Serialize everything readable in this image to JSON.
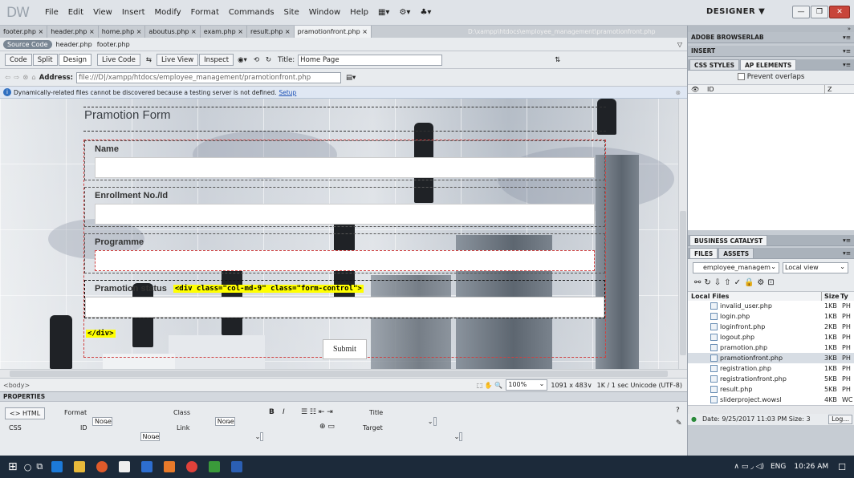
{
  "app": {
    "logo": "DW",
    "menu": [
      "File",
      "Edit",
      "View",
      "Insert",
      "Modify",
      "Format",
      "Commands",
      "Site",
      "Window",
      "Help"
    ],
    "workspace": "DESIGNER ▼",
    "window_controls": [
      "—",
      "❐",
      "✕"
    ]
  },
  "doc_tabs": [
    "footer.php ×",
    "header.php ×",
    "home.php ×",
    "aboutus.php ×",
    "exam.php ×",
    "result.php ×",
    "pramotionfront.php ×"
  ],
  "doc_path": "D:\\xampp\\htdocs\\employee_management\\pramotionfront.php",
  "related": {
    "source": "Source Code",
    "files": [
      "header.php",
      "footer.php"
    ]
  },
  "viewbar": {
    "buttons": [
      "Code",
      "Split",
      "Design",
      "Live Code",
      "Live View",
      "Inspect"
    ],
    "title_label": "Title:",
    "title_value": "Home Page"
  },
  "address": {
    "label": "Address:",
    "value": "file:///D|/xampp/htdocs/employee_management/pramotionfront.php"
  },
  "info": {
    "text": "Dynamically-related files cannot be discovered because a testing server is not defined.",
    "link": "Setup"
  },
  "form": {
    "heading": "Pramotion Form",
    "fields": [
      {
        "label": "Name"
      },
      {
        "label": "Enrollment No./Id"
      },
      {
        "label": "Programme"
      },
      {
        "label": "Pramotion status"
      }
    ],
    "tag_open": "<div class=\"col-md-9\" class=\"form-control\">",
    "tag_close": "</div>",
    "submit": "Submit"
  },
  "status": {
    "tag": "<body>",
    "zoom": "100%",
    "size": "1091 x 483∨",
    "info": "1K / 1 sec  Unicode (UTF-8)"
  },
  "properties": {
    "title": "PROPERTIES",
    "html": "<> HTML",
    "css": "CSS",
    "format_label": "Format",
    "format_value": "None",
    "class_label": "Class",
    "class_value": "None",
    "id_label": "ID",
    "id_value": "None",
    "link_label": "Link",
    "title_label": "Title",
    "target_label": "Target"
  },
  "panels": {
    "browserlab": "ADOBE BROWSERLAB",
    "insert": "INSERT",
    "tabs1": [
      "CSS STYLES",
      "AP ELEMENTS"
    ],
    "prevent": "Prevent overlaps",
    "col_id": "ID",
    "col_z": "Z",
    "business": "BUSINESS CATALYST",
    "tabs2": [
      "FILES",
      "ASSETS"
    ],
    "site": "employee_managem",
    "view": "Local view",
    "local_files": "Local Files",
    "size_col": "Size",
    "type_col": "Ty",
    "files": [
      {
        "name": "invalid_user.php",
        "size": "1KB",
        "type": "PH"
      },
      {
        "name": "login.php",
        "size": "1KB",
        "type": "PH"
      },
      {
        "name": "loginfront.php",
        "size": "2KB",
        "type": "PH"
      },
      {
        "name": "logout.php",
        "size": "1KB",
        "type": "PH"
      },
      {
        "name": "pramotion.php",
        "size": "1KB",
        "type": "PH"
      },
      {
        "name": "pramotionfront.php",
        "size": "3KB",
        "type": "PH"
      },
      {
        "name": "registration.php",
        "size": "1KB",
        "type": "PH"
      },
      {
        "name": "registrationfront.php",
        "size": "5KB",
        "type": "PH"
      },
      {
        "name": "result.php",
        "size": "5KB",
        "type": "PH"
      },
      {
        "name": "sliderproject.wowsl",
        "size": "4KB",
        "type": "WC"
      }
    ],
    "date": "Date: 9/25/2017 11:03 PM  Size: 3",
    "log": "Log..."
  },
  "taskbar": {
    "lang": "ENG",
    "time": "10:26 AM"
  }
}
